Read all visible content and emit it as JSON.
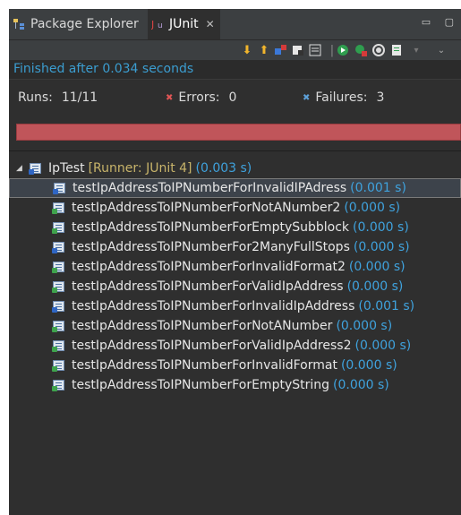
{
  "tabs": [
    {
      "label": "Package Explorer",
      "icon": "package-explorer-icon"
    },
    {
      "label": "JUnit",
      "icon": "junit-icon",
      "close": "✕"
    }
  ],
  "status": {
    "finished": "Finished after 0.034 seconds"
  },
  "counters": {
    "runs_label": "Runs:",
    "runs_value": "11/11",
    "errors_label": "Errors:",
    "errors_value": "0",
    "failures_label": "Failures:",
    "failures_value": "3"
  },
  "colors": {
    "progress_bar": "#c0555a",
    "time_text": "#3fa2dd",
    "runner_text": "#c8b46a"
  },
  "root": {
    "name": "IpTest",
    "runner": "[Runner: JUnit 4]",
    "time": "(0.003 s)"
  },
  "tests": [
    {
      "name": "testIpAddressToIPNumberForInvalidIPAdress",
      "time": "(0.001 s)",
      "status": "failure"
    },
    {
      "name": "testIpAddressToIPNumberForNotANumber2",
      "time": "(0.000 s)",
      "status": "pass"
    },
    {
      "name": "testIpAddressToIPNumberForEmptySubblock",
      "time": "(0.000 s)",
      "status": "pass"
    },
    {
      "name": "testIpAddressToIPNumberFor2ManyFullStops",
      "time": "(0.000 s)",
      "status": "failure"
    },
    {
      "name": "testIpAddressToIPNumberForInvalidFormat2",
      "time": "(0.000 s)",
      "status": "pass"
    },
    {
      "name": "testIpAddressToIPNumberForValidIpAddress",
      "time": "(0.000 s)",
      "status": "pass"
    },
    {
      "name": "testIpAddressToIPNumberForInvalidIpAddress",
      "time": "(0.001 s)",
      "status": "failure"
    },
    {
      "name": "testIpAddressToIPNumberForNotANumber",
      "time": "(0.000 s)",
      "status": "pass"
    },
    {
      "name": "testIpAddressToIPNumberForValidIpAddress2",
      "time": "(0.000 s)",
      "status": "pass"
    },
    {
      "name": "testIpAddressToIPNumberForInvalidFormat",
      "time": "(0.000 s)",
      "status": "pass"
    },
    {
      "name": "testIpAddressToIPNumberForEmptyString",
      "time": "(0.000 s)",
      "status": "pass"
    }
  ]
}
